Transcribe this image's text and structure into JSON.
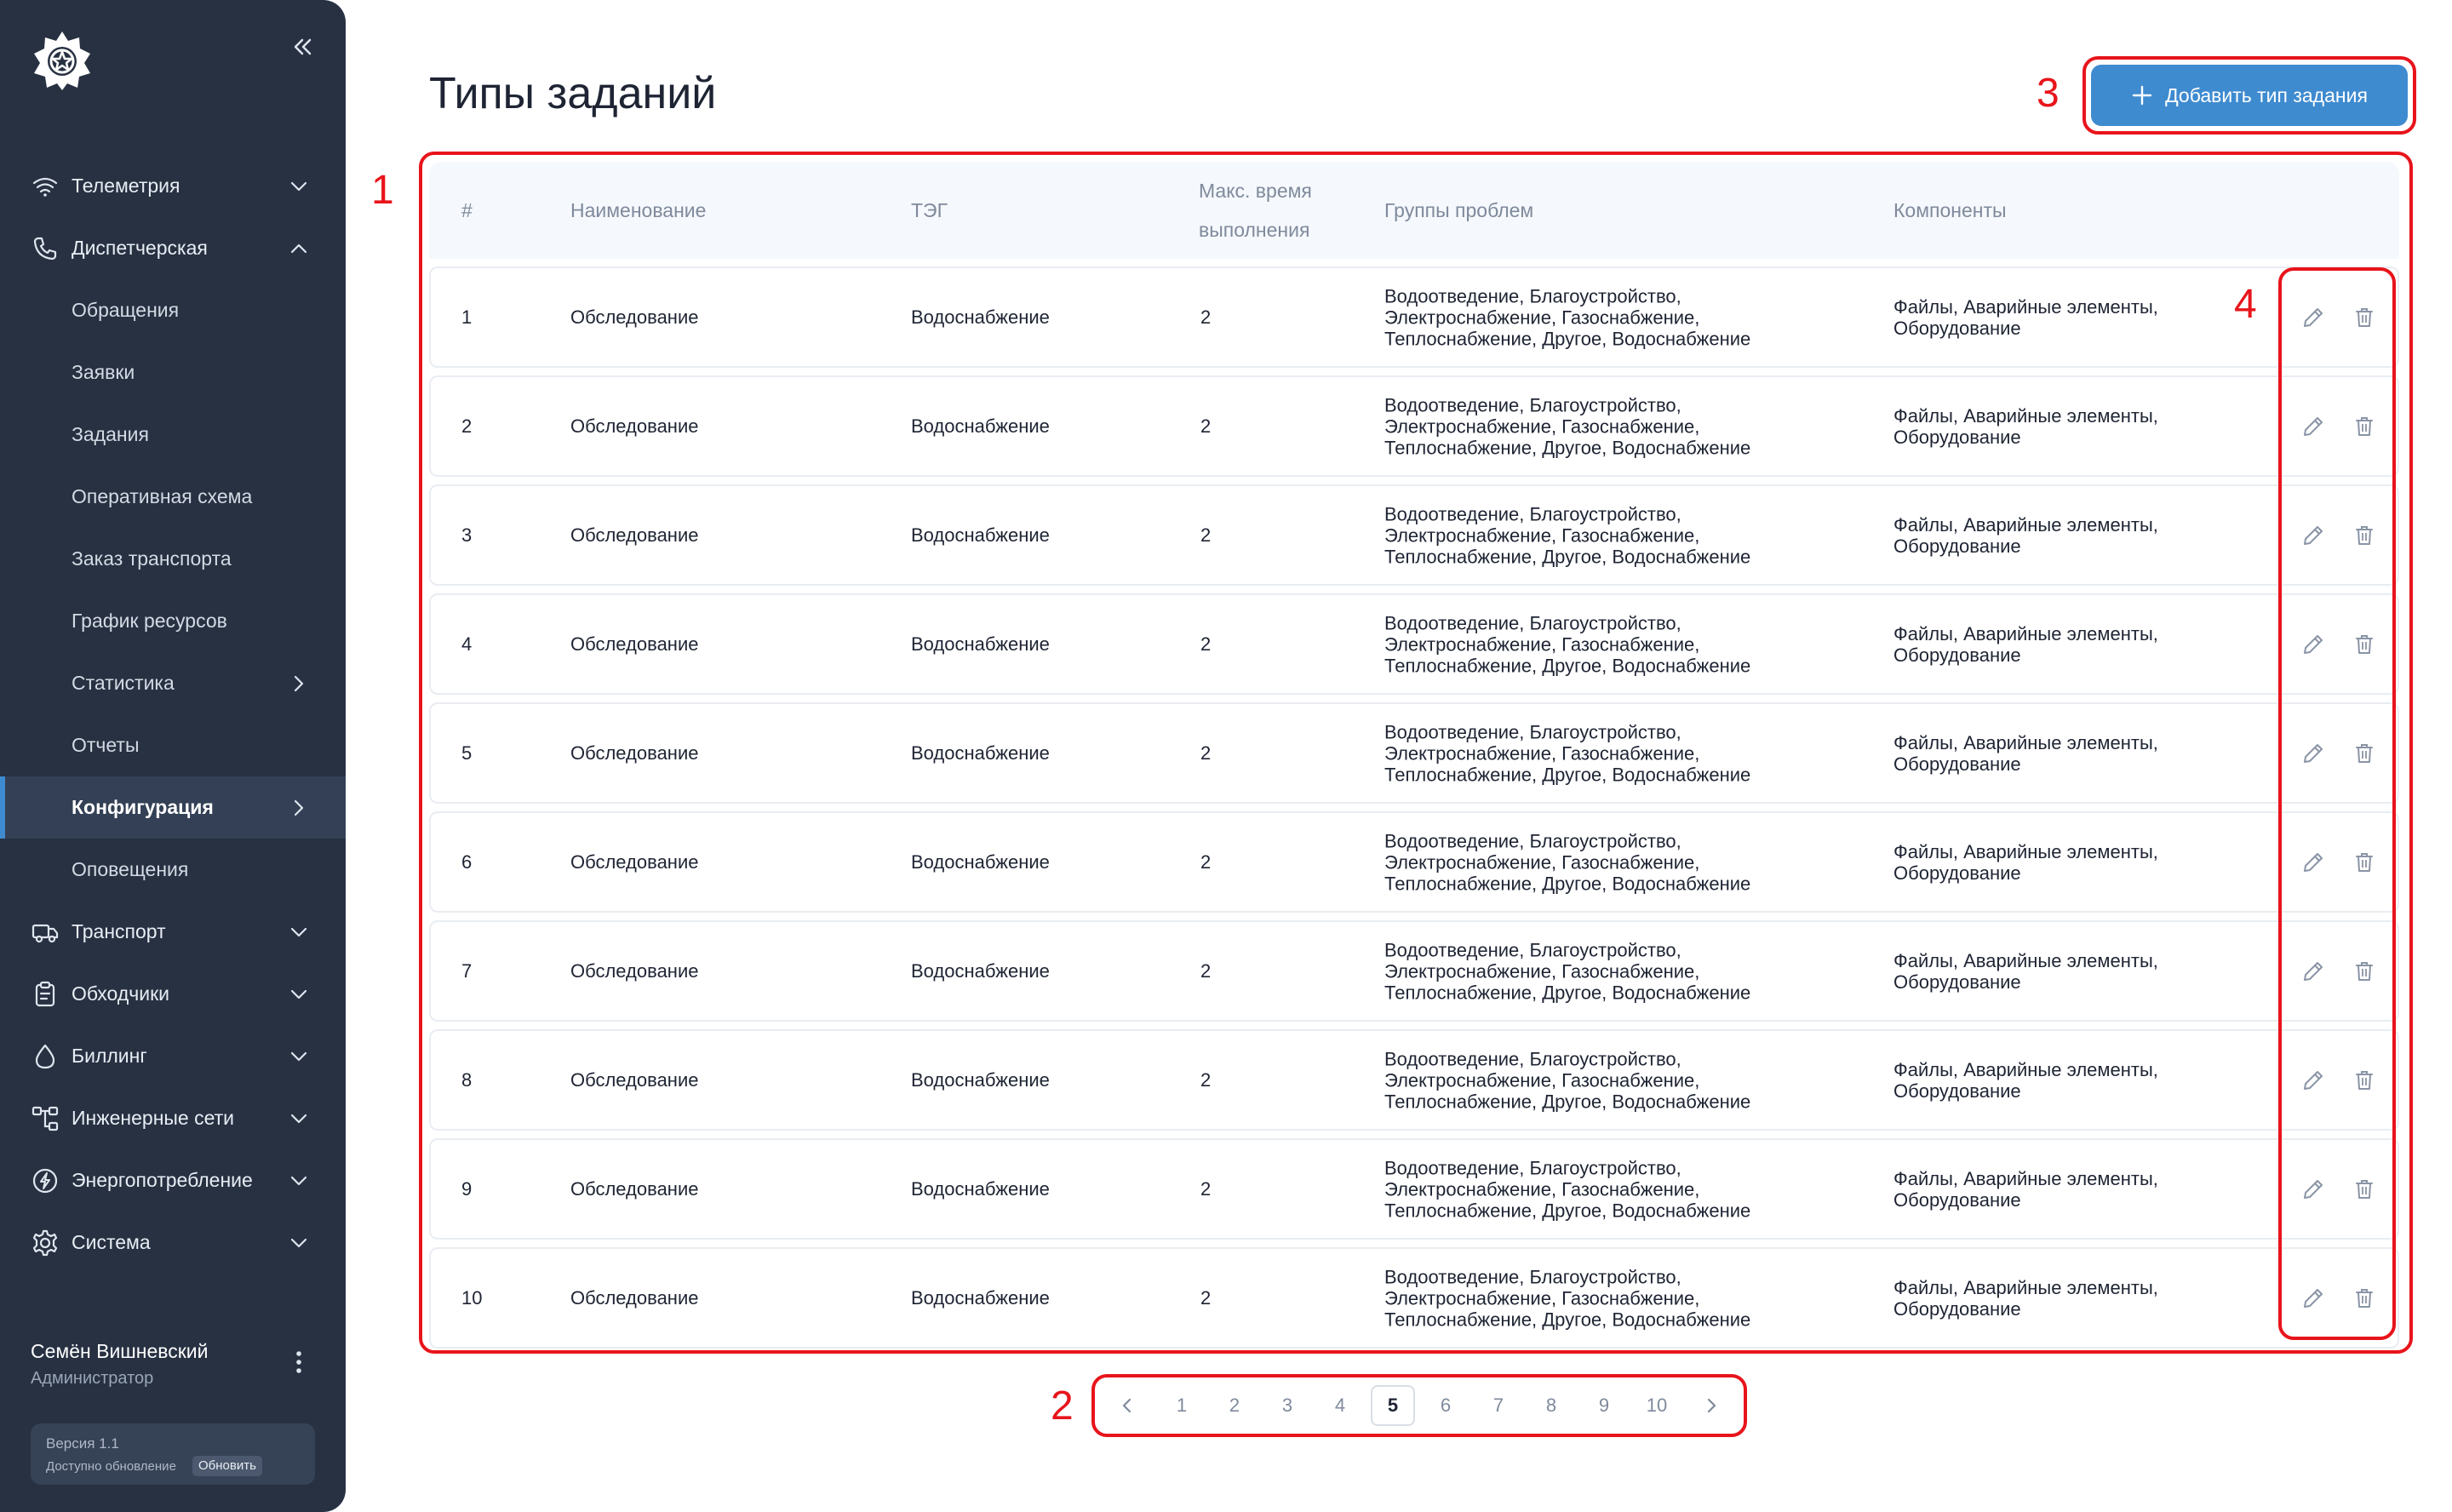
{
  "sidebar": {
    "logo_icon": "star-wheel-logo",
    "collapse_icon": "double-chevron-left-icon",
    "items": [
      {
        "label": "Телеметрия",
        "icon": "wifi-icon",
        "chevron": "down",
        "sub": false,
        "active": false
      },
      {
        "label": "Диспетчерская",
        "icon": "phone-icon",
        "chevron": "up",
        "sub": false,
        "active": false
      },
      {
        "label": "Обращения",
        "icon": "",
        "chevron": "",
        "sub": true,
        "active": false
      },
      {
        "label": "Заявки",
        "icon": "",
        "chevron": "",
        "sub": true,
        "active": false
      },
      {
        "label": "Задания",
        "icon": "",
        "chevron": "",
        "sub": true,
        "active": false
      },
      {
        "label": "Оперативная схема",
        "icon": "",
        "chevron": "",
        "sub": true,
        "active": false
      },
      {
        "label": "Заказ транспорта",
        "icon": "",
        "chevron": "",
        "sub": true,
        "active": false
      },
      {
        "label": "График ресурсов",
        "icon": "",
        "chevron": "",
        "sub": true,
        "active": false
      },
      {
        "label": "Статистика",
        "icon": "",
        "chevron": "right",
        "sub": true,
        "active": false
      },
      {
        "label": "Отчеты",
        "icon": "",
        "chevron": "",
        "sub": true,
        "active": false
      },
      {
        "label": "Конфигурация",
        "icon": "",
        "chevron": "right",
        "sub": true,
        "active": true
      },
      {
        "label": "Оповещения",
        "icon": "",
        "chevron": "",
        "sub": true,
        "active": false
      },
      {
        "label": "Транспорт",
        "icon": "truck-icon",
        "chevron": "down",
        "sub": false,
        "active": false
      },
      {
        "label": "Обходчики",
        "icon": "clipboard-icon",
        "chevron": "down",
        "sub": false,
        "active": false
      },
      {
        "label": "Биллинг",
        "icon": "drop-icon",
        "chevron": "down",
        "sub": false,
        "active": false
      },
      {
        "label": "Инженерные сети",
        "icon": "network-icon",
        "chevron": "down",
        "sub": false,
        "active": false
      },
      {
        "label": "Энергопотребление",
        "icon": "energy-icon",
        "chevron": "down",
        "sub": false,
        "active": false
      },
      {
        "label": "Система",
        "icon": "gear-icon",
        "chevron": "down",
        "sub": false,
        "active": false
      }
    ],
    "user": {
      "name": "Семён Вишневский",
      "role": "Администратор"
    },
    "version": {
      "label": "Версия 1.1",
      "update_text": "Доступно обновление",
      "update_button": "Обновить"
    }
  },
  "header": {
    "title": "Типы заданий",
    "add_button": "Добавить тип задания"
  },
  "table": {
    "columns": [
      "#",
      "Наименование",
      "ТЭГ",
      "Макс. время выполнения",
      "Группы проблем",
      "Компоненты"
    ],
    "columns_display": {
      "num": "#",
      "name": "Наименование",
      "teg": "ТЭГ",
      "time_line1": "Макс. время",
      "time_line2": "выполнения",
      "groups": "Группы проблем",
      "components": "Компоненты"
    },
    "rows": [
      {
        "num": "1",
        "name": "Обследование",
        "teg": "Водоснабжение",
        "time": "2",
        "groups_l1": "Водоотведение, Благоустройство,",
        "groups_l2": "Электроснабжение, Газоснабжение,",
        "groups_l3": "Теплоснабжение, Другое, Водоснабжение",
        "comp_l1": "Файлы, Аварийные элементы,",
        "comp_l2": "Оборудование"
      },
      {
        "num": "2",
        "name": "Обследование",
        "teg": "Водоснабжение",
        "time": "2",
        "groups_l1": "Водоотведение, Благоустройство,",
        "groups_l2": "Электроснабжение, Газоснабжение,",
        "groups_l3": "Теплоснабжение, Другое, Водоснабжение",
        "comp_l1": "Файлы, Аварийные элементы,",
        "comp_l2": "Оборудование"
      },
      {
        "num": "3",
        "name": "Обследование",
        "teg": "Водоснабжение",
        "time": "2",
        "groups_l1": "Водоотведение, Благоустройство,",
        "groups_l2": "Электроснабжение, Газоснабжение,",
        "groups_l3": "Теплоснабжение, Другое, Водоснабжение",
        "comp_l1": "Файлы, Аварийные элементы,",
        "comp_l2": "Оборудование"
      },
      {
        "num": "4",
        "name": "Обследование",
        "teg": "Водоснабжение",
        "time": "2",
        "groups_l1": "Водоотведение, Благоустройство,",
        "groups_l2": "Электроснабжение, Газоснабжение,",
        "groups_l3": "Теплоснабжение, Другое, Водоснабжение",
        "comp_l1": "Файлы, Аварийные элементы,",
        "comp_l2": "Оборудование"
      },
      {
        "num": "5",
        "name": "Обследование",
        "teg": "Водоснабжение",
        "time": "2",
        "groups_l1": "Водоотведение, Благоустройство,",
        "groups_l2": "Электроснабжение, Газоснабжение,",
        "groups_l3": "Теплоснабжение, Другое, Водоснабжение",
        "comp_l1": "Файлы, Аварийные элементы,",
        "comp_l2": "Оборудование"
      },
      {
        "num": "6",
        "name": "Обследование",
        "teg": "Водоснабжение",
        "time": "2",
        "groups_l1": "Водоотведение, Благоустройство,",
        "groups_l2": "Электроснабжение, Газоснабжение,",
        "groups_l3": "Теплоснабжение, Другое, Водоснабжение",
        "comp_l1": "Файлы, Аварийные элементы,",
        "comp_l2": "Оборудование"
      },
      {
        "num": "7",
        "name": "Обследование",
        "teg": "Водоснабжение",
        "time": "2",
        "groups_l1": "Водоотведение, Благоустройство,",
        "groups_l2": "Электроснабжение, Газоснабжение,",
        "groups_l3": "Теплоснабжение, Другое, Водоснабжение",
        "comp_l1": "Файлы, Аварийные элементы,",
        "comp_l2": "Оборудование"
      },
      {
        "num": "8",
        "name": "Обследование",
        "teg": "Водоснабжение",
        "time": "2",
        "groups_l1": "Водоотведение, Благоустройство,",
        "groups_l2": "Электроснабжение, Газоснабжение,",
        "groups_l3": "Теплоснабжение, Другое, Водоснабжение",
        "comp_l1": "Файлы, Аварийные элементы,",
        "comp_l2": "Оборудование"
      },
      {
        "num": "9",
        "name": "Обследование",
        "teg": "Водоснабжение",
        "time": "2",
        "groups_l1": "Водоотведение, Благоустройство,",
        "groups_l2": "Электроснабжение, Газоснабжение,",
        "groups_l3": "Теплоснабжение, Другое, Водоснабжение",
        "comp_l1": "Файлы, Аварийные элементы,",
        "comp_l2": "Оборудование"
      },
      {
        "num": "10",
        "name": "Обследование",
        "teg": "Водоснабжение",
        "time": "2",
        "groups_l1": "Водоотведение, Благоустройство,",
        "groups_l2": "Электроснабжение, Газоснабжение,",
        "groups_l3": "Теплоснабжение, Другое, Водоснабжение",
        "comp_l1": "Файлы, Аварийные элементы,",
        "comp_l2": "Оборудование"
      }
    ],
    "row_actions": [
      "pencil-icon",
      "trash-icon"
    ]
  },
  "pagination": {
    "pages": [
      "1",
      "2",
      "3",
      "4",
      "5",
      "6",
      "7",
      "8",
      "9",
      "10"
    ],
    "current": "5"
  },
  "annotations": {
    "table": "1",
    "pagination": "2",
    "add_button": "3",
    "row_actions": "4",
    "color": "#e8141b"
  },
  "colors": {
    "sidebar_bg": "#273142",
    "accent": "#3f8bd0",
    "annotation": "#e8141b"
  }
}
